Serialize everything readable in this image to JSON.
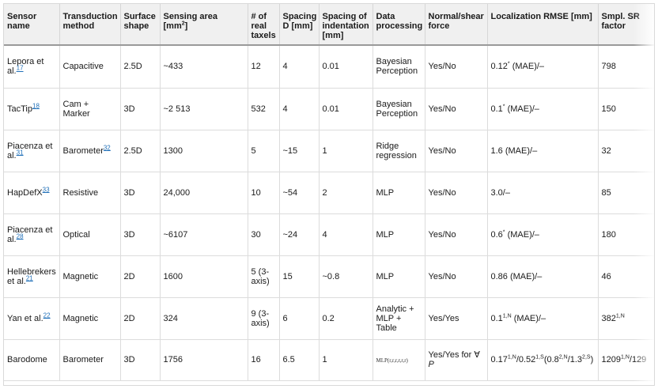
{
  "headers": [
    {
      "l1": "Sensor",
      "l2": "name",
      "l3": ""
    },
    {
      "l1": "Transduction",
      "l2": "method",
      "l3": ""
    },
    {
      "l1": "Surface",
      "l2": "shape",
      "l3": ""
    },
    {
      "l1": "Sensing area [mm",
      "l2": "",
      "l3": "",
      "sup": "2",
      "after": "]"
    },
    {
      "l1": "# of",
      "l2": "real",
      "l3": "taxels"
    },
    {
      "l1": "Spacing",
      "l2": "D [mm]",
      "l3": ""
    },
    {
      "l1": "Spacing of",
      "l2": "indentation",
      "l3": "[mm]"
    },
    {
      "l1": "Data",
      "l2": "processing",
      "l3": ""
    },
    {
      "l1": "Normal/shear",
      "l2": "force",
      "l3": ""
    },
    {
      "l1": "Localization RMSE [mm]",
      "l2": "",
      "l3": ""
    },
    {
      "l1": "Smpl. SR",
      "l2": "factor",
      "l3": ""
    }
  ],
  "rows": [
    {
      "name1": "Lepora et",
      "name2": "al.",
      "ref": "17",
      "method": "Capacitive",
      "method_ref": "",
      "shape": "2.5D",
      "area": "~433",
      "taxels1": "12",
      "taxels2": "",
      "spacing": "4",
      "indent": "0.01",
      "proc1": "Bayesian",
      "proc2": "Perception",
      "force1": "Yes/No",
      "force2": "",
      "rmse_pre": "0.12",
      "rmse_sup": "*",
      "rmse_post": " (MAE)/–",
      "sr": "798",
      "sr_sup": ""
    },
    {
      "name1": "TacTip",
      "name2": "",
      "ref": "18",
      "method": "Cam + Marker",
      "method_ref": "",
      "shape": "3D",
      "area": "~2 513",
      "taxels1": "532",
      "taxels2": "",
      "spacing": "4",
      "indent": "0.01",
      "proc1": "Bayesian",
      "proc2": "Perception",
      "force1": "Yes/No",
      "force2": "",
      "rmse_pre": "0.1",
      "rmse_sup": "*",
      "rmse_post": " (MAE)/–",
      "sr": "150",
      "sr_sup": ""
    },
    {
      "name1": "Piacenza et",
      "name2": "al.",
      "ref": "31",
      "method": "Barometer",
      "method_ref": "32",
      "shape": "2.5D",
      "area": "1300",
      "taxels1": "5",
      "taxels2": "",
      "spacing": "~15",
      "indent": "1",
      "proc1": "Ridge",
      "proc2": "regression",
      "force1": "Yes/No",
      "force2": "",
      "rmse_pre": "1.6 (MAE)/–",
      "rmse_sup": "",
      "rmse_post": "",
      "sr": "32",
      "sr_sup": ""
    },
    {
      "name1": "HapDefX",
      "name2": "",
      "ref": "33",
      "method": "Resistive",
      "method_ref": "",
      "shape": "3D",
      "area": "24,000",
      "taxels1": "10",
      "taxels2": "",
      "spacing": "~54",
      "indent": "2",
      "proc1": "MLP",
      "proc2": "",
      "force1": "Yes/No",
      "force2": "",
      "rmse_pre": "3.0/–",
      "rmse_sup": "",
      "rmse_post": "",
      "sr": "85",
      "sr_sup": ""
    },
    {
      "name1": "Piacenza et",
      "name2": "al.",
      "ref": "28",
      "method": "Optical",
      "method_ref": "",
      "shape": "3D",
      "area": "~6107",
      "taxels1": "30",
      "taxels2": "",
      "spacing": "~24",
      "indent": "4",
      "proc1": "MLP",
      "proc2": "",
      "force1": "Yes/No",
      "force2": "",
      "rmse_pre": "0.6",
      "rmse_sup": "*",
      "rmse_post": " (MAE)/–",
      "sr": "180",
      "sr_sup": ""
    },
    {
      "name1": "Hellebrekers",
      "name2": "et al.",
      "ref": "21",
      "method": "Magnetic",
      "method_ref": "",
      "shape": "2D",
      "area": "1600",
      "taxels1": "5 (3-",
      "taxels2": "axis)",
      "spacing": "15",
      "indent": "~0.8",
      "proc1": "MLP",
      "proc2": "",
      "force1": "Yes/No",
      "force2": "",
      "rmse_pre": "0.86 (MAE)/–",
      "rmse_sup": "",
      "rmse_post": "",
      "sr": "46",
      "sr_sup": ""
    },
    {
      "name1": "Yan et al.",
      "name2": "",
      "ref": "22",
      "method": "Magnetic",
      "method_ref": "",
      "shape": "2D",
      "area": "324",
      "taxels1": "9 (3-",
      "taxels2": "axis)",
      "spacing": "6",
      "indent": "0.2",
      "proc1": "Analytic +",
      "proc2": "MLP + Table",
      "force1": "Yes/Yes",
      "force2": "",
      "rmse_pre": "0.1",
      "rmse_sup": "1,N",
      "rmse_post": " (MAE)/–",
      "sr": "382",
      "sr_sup": "1,N"
    },
    {
      "name1": "Barodome",
      "name2": "",
      "ref": "",
      "method": "Barometer",
      "method_ref": "",
      "shape": "3D",
      "area": "1756",
      "taxels1": "16",
      "taxels2": "",
      "spacing": "6.5",
      "indent": "1",
      "proc1": "MLP(r,r,r,r,r,r)",
      "proc2": "",
      "force1": "Yes/Yes for ∀",
      "force2": "P",
      "rmse_pre": "0.17",
      "rmse_sup": "1,N",
      "rmse_post": "/0.52",
      "rmse_sup2": "1,S",
      "rmse_post2": "(0.8",
      "rmse_sup3": "2,N",
      "rmse_post3": "/1.3",
      "rmse_sup4": "2,S",
      "rmse_post4": ")",
      "sr": "1209",
      "sr_sup": "1,N",
      "sr_post": "/129"
    }
  ]
}
